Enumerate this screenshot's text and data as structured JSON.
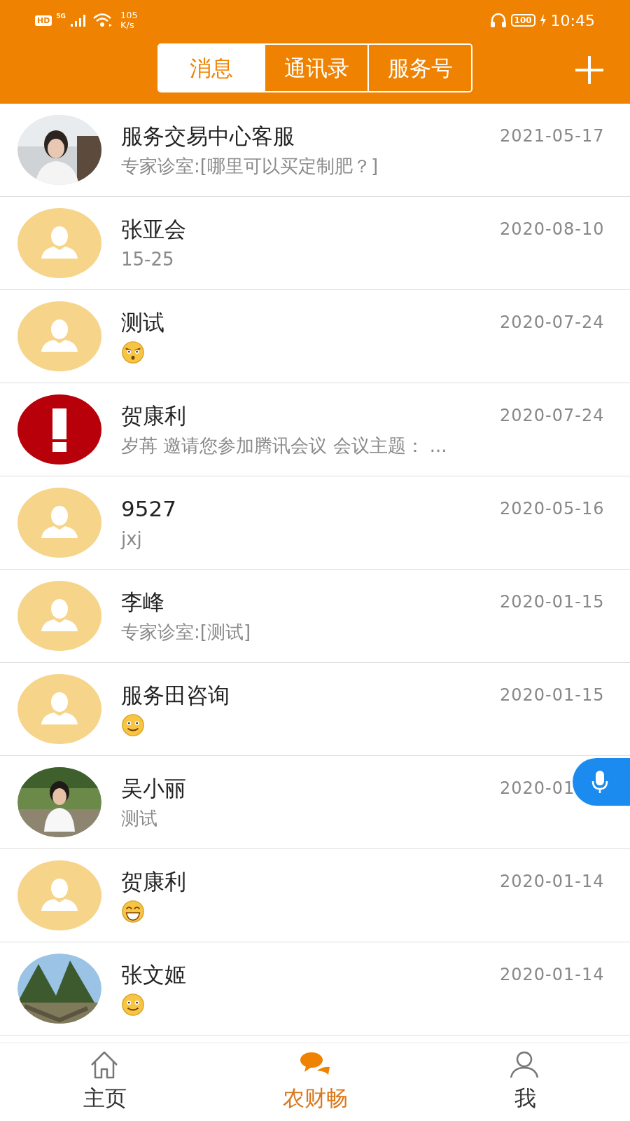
{
  "status_bar": {
    "hd": "HD",
    "network": "5G",
    "speed": "105",
    "speed_unit": "K/s",
    "battery": "100",
    "time": "10:45"
  },
  "tabs": [
    {
      "label": "消息",
      "selected": true
    },
    {
      "label": "通讯录",
      "selected": false
    },
    {
      "label": "服务号",
      "selected": false
    }
  ],
  "conversations": [
    {
      "name": "服务交易中心客服",
      "date": "2021-05-17",
      "preview": {
        "kind": "text",
        "text": "专家诊室:[哪里可以买定制肥？]"
      }
    },
    {
      "avatar": {
        "kind": "default"
      },
      "name": "张亚会",
      "date": "2020-08-10",
      "preview": {
        "kind": "text",
        "text": "15-25"
      }
    },
    {
      "avatar": {
        "kind": "default"
      },
      "name": "测试",
      "date": "2020-07-24",
      "preview": {
        "kind": "angry"
      }
    },
    {
      "avatar": {
        "kind": "alert"
      },
      "name": "贺康利",
      "date": "2020-07-24",
      "preview": {
        "kind": "text",
        "text": "岁苒 邀请您参加腾讯会议 会议主题： ..."
      }
    },
    {
      "avatar": {
        "kind": "default"
      },
      "name": "9527",
      "date": "2020-05-16",
      "preview": {
        "kind": "text",
        "text": "jxj"
      }
    },
    {
      "avatar": {
        "kind": "default"
      },
      "name": "李峰",
      "date": "2020-01-15",
      "preview": {
        "kind": "text",
        "text": "专家诊室:[测试]"
      }
    },
    {
      "avatar": {
        "kind": "default"
      },
      "name": "服务田咨询",
      "date": "2020-01-15",
      "preview": {
        "kind": "smile"
      }
    },
    {
      "name": "吴小丽",
      "date": "2020-01",
      "preview": {
        "kind": "text",
        "text": "测试"
      }
    },
    {
      "avatar": {
        "kind": "default"
      },
      "name": "贺康利",
      "date": "2020-01-14",
      "preview": {
        "kind": "grin"
      }
    },
    {
      "name": "张文姬",
      "date": "2020-01-14",
      "preview": {
        "kind": "smile"
      }
    }
  ],
  "bottom_nav": [
    {
      "label": "主页",
      "selected": false
    },
    {
      "label": "农财畅",
      "selected": true
    },
    {
      "label": "我",
      "selected": false
    }
  ]
}
